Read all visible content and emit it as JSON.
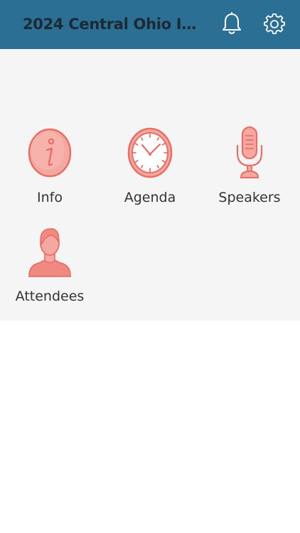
{
  "header": {
    "title": "2024 Central Ohio Inf...",
    "bell_icon": "bell-icon",
    "settings_icon": "gear-icon",
    "background": "#2b6f94"
  },
  "tiles": [
    {
      "label": "Info",
      "icon": "info-icon"
    },
    {
      "label": "Agenda",
      "icon": "clock-icon"
    },
    {
      "label": "Speakers",
      "icon": "microphone-icon"
    },
    {
      "label": "Attendees",
      "icon": "person-icon"
    }
  ],
  "colors": {
    "icon_accent": "#e86e66",
    "icon_fill": "#f4a8a0",
    "content_bg": "#f5f5f5"
  }
}
